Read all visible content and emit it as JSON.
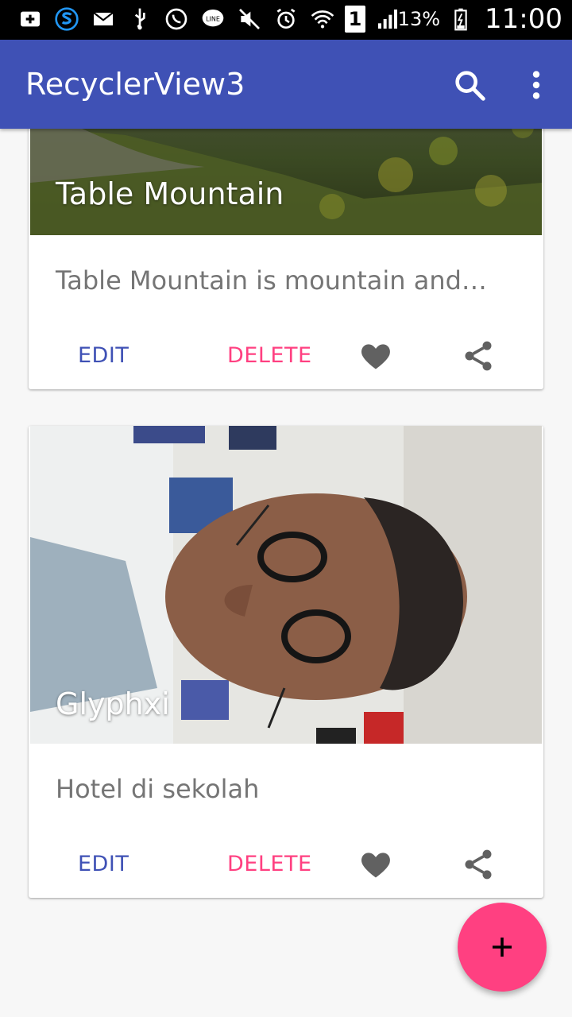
{
  "status_bar": {
    "battery": "13%",
    "time": "11:00",
    "sim": "1",
    "icons": [
      "add-box-icon",
      "s-app-icon",
      "mail-icon",
      "usb-icon",
      "whatsapp-icon",
      "line-icon",
      "mute-icon",
      "alarm-icon",
      "wifi-icon",
      "sim-icon",
      "signal-icon",
      "battery-icon"
    ]
  },
  "app_bar": {
    "title": "RecyclerView3",
    "search_icon": "search-icon",
    "more_icon": "more-vert-icon"
  },
  "cards": [
    {
      "title": "Table Mountain",
      "description": "Table Mountain is mountain and…",
      "edit_label": "EDIT",
      "delete_label": "DELETE",
      "favorite_icon": "heart-icon",
      "share_icon": "share-icon"
    },
    {
      "title": "Glyphxi",
      "description": "Hotel di sekolah",
      "edit_label": "EDIT",
      "delete_label": "DELETE",
      "favorite_icon": "heart-icon",
      "share_icon": "share-icon"
    }
  ],
  "fab": {
    "icon": "add-icon"
  },
  "colors": {
    "primary": "#3f51b5",
    "accent": "#ff4081",
    "background": "#f7f7f7"
  }
}
